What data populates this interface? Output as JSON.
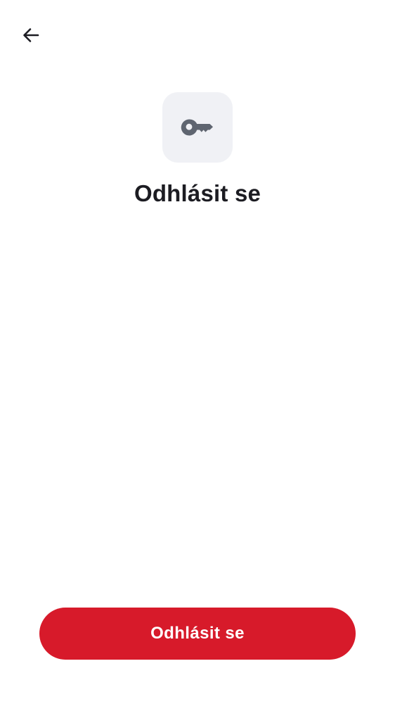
{
  "header": {
    "back_icon": "arrow-left-icon"
  },
  "hero": {
    "icon": "key-icon",
    "title": "Odhlásit se"
  },
  "footer": {
    "logout_label": "Odhlásit se"
  },
  "colors": {
    "accent": "#d71a2a",
    "tile_background": "#f0f1f5",
    "icon_gray": "#5f6570",
    "text_dark": "#1c1c22"
  }
}
